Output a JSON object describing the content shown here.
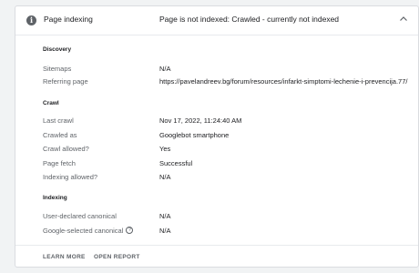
{
  "header": {
    "icon": "info-icon",
    "title": "Page indexing",
    "status": "Page is not indexed: Crawled - currently not indexed",
    "toggle_icon": "chevron-up-icon"
  },
  "discovery": {
    "heading": "Discovery",
    "rows": [
      {
        "label": "Sitemaps",
        "value": "N/A"
      },
      {
        "label": "Referring page",
        "value": "https://pavelandreev.bg/forum/resources/infarkt-simptomi-lechenie-i-prevencija.77/"
      }
    ]
  },
  "crawl": {
    "heading": "Crawl",
    "rows": [
      {
        "label": "Last crawl",
        "value": "Nov 17, 2022, 11:24:40 AM"
      },
      {
        "label": "Crawled as",
        "value": "Googlebot smartphone"
      },
      {
        "label": "Crawl allowed?",
        "value": "Yes"
      },
      {
        "label": "Page fetch",
        "value": "Successful"
      },
      {
        "label": "Indexing allowed?",
        "value": "N/A"
      }
    ]
  },
  "indexing": {
    "heading": "Indexing",
    "rows": [
      {
        "label": "User-declared canonical",
        "value": "N/A"
      },
      {
        "label": "Google-selected canonical",
        "value": "N/A",
        "help_icon": "help-icon"
      }
    ]
  },
  "footer": {
    "learn_more": "LEARN MORE",
    "open_report": "OPEN REPORT"
  }
}
